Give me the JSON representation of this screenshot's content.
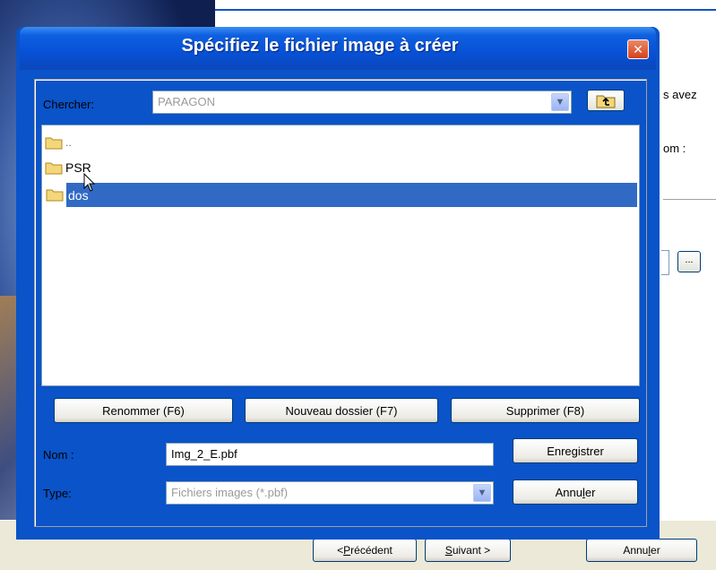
{
  "dialog": {
    "title": "Spécifiez le fichier image à créer",
    "look_in_label": "Chercher:",
    "look_in_value": "PARAGON",
    "files": [
      {
        "name": ".."
      },
      {
        "name": "PSR"
      },
      {
        "name": "dos",
        "selected": true
      }
    ],
    "buttons": {
      "rename": "Renommer (F6)",
      "new_folder": "Nouveau dossier (F7)",
      "delete": "Supprimer (F8)",
      "save": "Enregistrer",
      "cancel_pre": "Annu",
      "cancel_key": "l",
      "cancel_post": "er"
    },
    "name_label": "Nom :",
    "name_value": "Img_2_E.pbf",
    "type_label": "Type:",
    "type_value": "Fichiers images (*.pbf)"
  },
  "background": {
    "text1": "s avez",
    "text2": "om :",
    "dots_button": "...",
    "prev_pre": "< ",
    "prev_key": "P",
    "prev_post": "récédent",
    "next_key": "S",
    "next_post": "uivant >",
    "cancel_pre": "Annu",
    "cancel_key": "l",
    "cancel_post": "er"
  },
  "colors": {
    "titlebar": "#0751d6",
    "selection": "#316ac5",
    "folder": "#f4d77a"
  }
}
